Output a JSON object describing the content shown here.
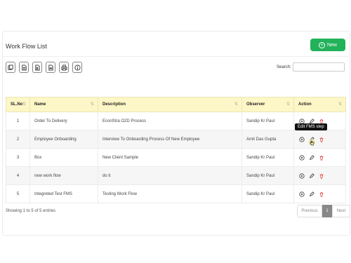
{
  "page": {
    "title": "Work Flow List",
    "new_label": "New"
  },
  "exports": [
    {
      "icon": "copy-icon"
    },
    {
      "icon": "csv-icon"
    },
    {
      "icon": "excel-icon"
    },
    {
      "icon": "pdf-icon"
    },
    {
      "icon": "print-icon"
    },
    {
      "icon": "info-icon"
    }
  ],
  "search": {
    "label": "Search:",
    "value": "",
    "placeholder": ""
  },
  "table": {
    "headers": [
      "SL.No",
      "Name",
      "Description",
      "Observer",
      "Action"
    ],
    "rows": [
      {
        "sl": "1",
        "name": "Order To Delivery",
        "description": "EconStra O2D Process",
        "observer": "Sandip Kr Paul"
      },
      {
        "sl": "2",
        "name": "Employee Onboarding",
        "description": "Interview To Onboarding Process Of New Employee",
        "observer": "Amit Das Gupta"
      },
      {
        "sl": "3",
        "name": "Box",
        "description": "New Client Sample",
        "observer": "Sandip Kr Paul"
      },
      {
        "sl": "4",
        "name": "new work flow",
        "description": "do it",
        "observer": "Sandip Kr Paul"
      },
      {
        "sl": "5",
        "name": "Integreted Test FMS",
        "description": "Testing Work Flow",
        "observer": "Sandip Kr Paul"
      }
    ]
  },
  "tooltip": "Edit FMS step",
  "footer": {
    "showing": "Showing 1 to 5 of 5 entries"
  },
  "pagination": {
    "prev": "Previous",
    "current": "1",
    "next": "Next"
  },
  "colors": {
    "accent": "#22b25a",
    "header_bg": "#fdf6c6",
    "delete": "#e04848"
  }
}
